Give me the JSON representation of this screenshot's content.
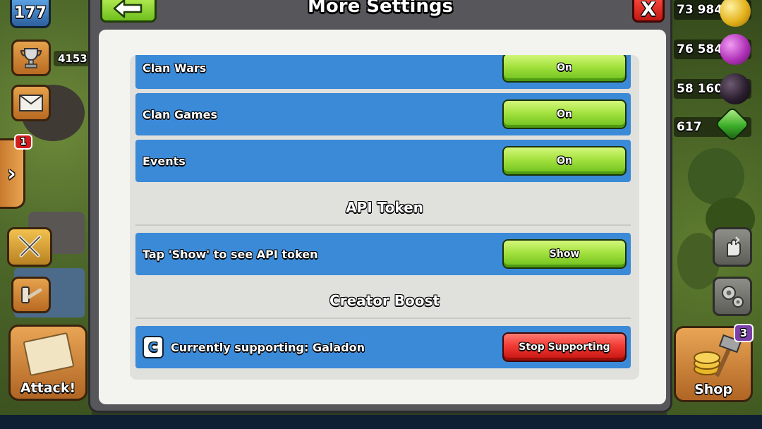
{
  "modal": {
    "title": "More Settings",
    "close_label": "X"
  },
  "settings": [
    {
      "label": "Clan Wars",
      "button": "On"
    },
    {
      "label": "Clan Games",
      "button": "On"
    },
    {
      "label": "Events",
      "button": "On"
    }
  ],
  "api_token": {
    "section_title": "API Token",
    "row_label": "Tap 'Show' to see API token",
    "button": "Show"
  },
  "creator_boost": {
    "section_title": "Creator Boost",
    "icon_letter": "C",
    "row_label": "Currently supporting: Galadon",
    "button": "Stop Supporting"
  },
  "hud_left": {
    "level": "177",
    "trophies": "4153",
    "notification_count": "1",
    "side_tab_glyph": "›",
    "attack_label": "Attack!"
  },
  "hud_right": {
    "gold": "73 984",
    "elixir": "76 584",
    "dark_elixir": "58 160",
    "gems": "617",
    "shop_label": "Shop",
    "shop_badge": "3"
  },
  "colors": {
    "row_blue": "#3a8ad8",
    "button_green": "#a4e23f",
    "button_red": "#f13a33",
    "modal_frame": "#57565a"
  }
}
